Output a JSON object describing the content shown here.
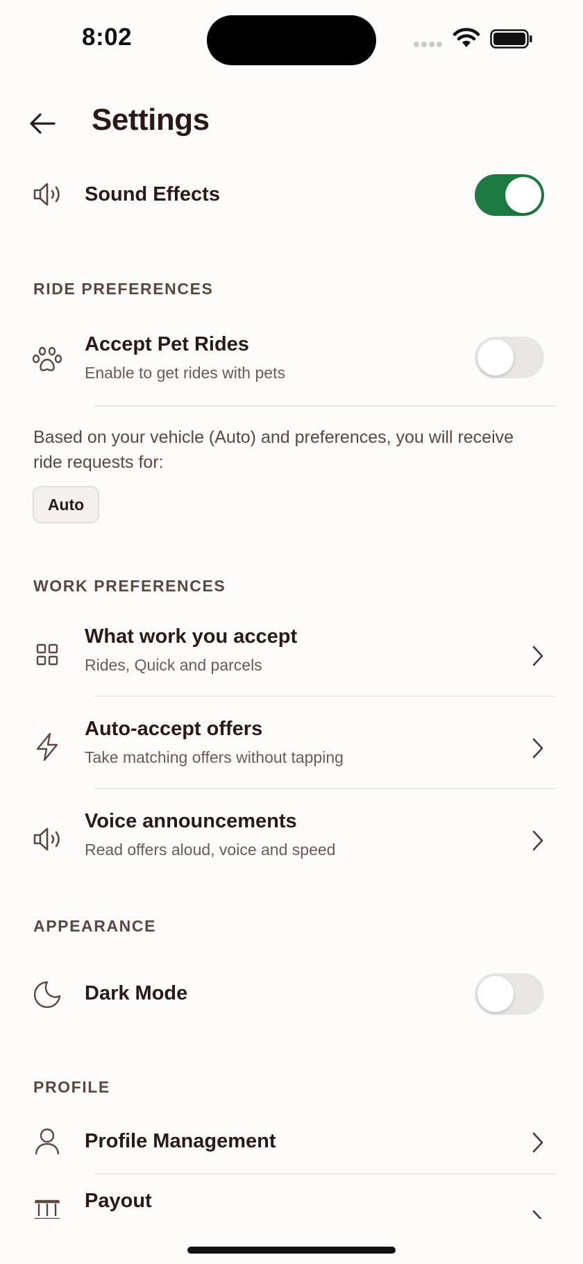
{
  "status_bar": {
    "time": "8:02"
  },
  "header": {
    "title": "Settings"
  },
  "sound_effects": {
    "label": "Sound Effects",
    "enabled": true
  },
  "ride_preferences": {
    "heading": "RIDE PREFERENCES",
    "pet_rides": {
      "title": "Accept Pet Rides",
      "subtitle": "Enable to get rides with pets",
      "enabled": false
    },
    "info_text": "Based on your vehicle (Auto) and preferences, you will receive ride requests for:",
    "chips": [
      "Auto"
    ]
  },
  "work_preferences": {
    "heading": "WORK PREFERENCES",
    "items": [
      {
        "title": "What work you accept",
        "subtitle": "Rides, Quick and parcels",
        "icon": "grid-icon"
      },
      {
        "title": "Auto-accept offers",
        "subtitle": "Take matching offers without tapping",
        "icon": "lightning-icon"
      },
      {
        "title": "Voice announcements",
        "subtitle": "Read offers aloud, voice and speed",
        "icon": "speaker-icon"
      }
    ]
  },
  "appearance": {
    "heading": "APPEARANCE",
    "dark_mode": {
      "label": "Dark Mode",
      "enabled": false,
      "icon": "moon-icon"
    }
  },
  "profile": {
    "heading": "PROFILE",
    "items": [
      {
        "title": "Profile Management",
        "icon": "person-icon"
      },
      {
        "title": "Payout",
        "icon": "bank-icon"
      }
    ]
  },
  "colors": {
    "accent": "#1E7A43",
    "text_primary": "#2A1A17",
    "text_secondary": "#6B5A55",
    "background": "#FDFCFB"
  }
}
